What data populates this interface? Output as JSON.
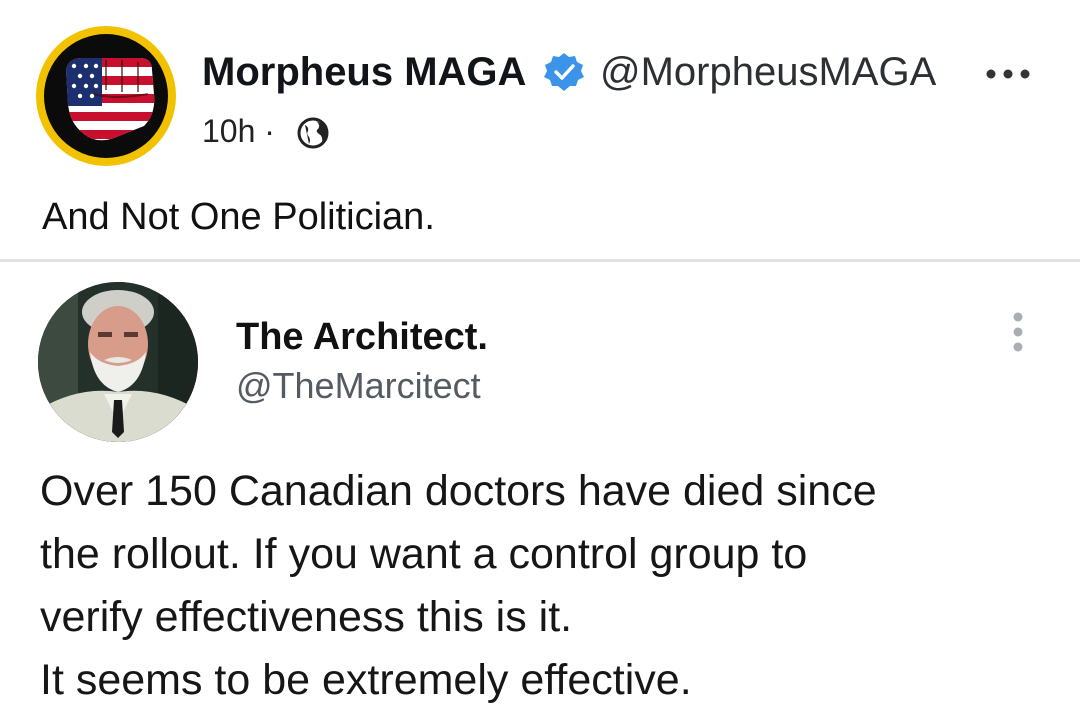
{
  "post": {
    "author_name": "Morpheus MAGA",
    "handle": "@MorpheusMAGA",
    "time": "10h",
    "separator": "·",
    "text": "And Not One Politician.",
    "icons": {
      "avatar": "fist-flag-avatar",
      "verified": "verified-badge-icon",
      "more": "more-horizontal-icon",
      "audience": "globe-icon"
    },
    "colors": {
      "verified_blue": "#3b94e8",
      "avatar_ring": "#f2c200"
    }
  },
  "quoted": {
    "author_name": "The Architect.",
    "handle": "@TheMarcitect",
    "lines": [
      "Over 150 Canadian doctors have died since",
      "the rollout. If you want a control group to",
      "verify effectiveness this is it.",
      "It seems to be extremely effective."
    ],
    "icons": {
      "avatar": "bearded-man-avatar",
      "more": "more-vertical-icon"
    }
  }
}
